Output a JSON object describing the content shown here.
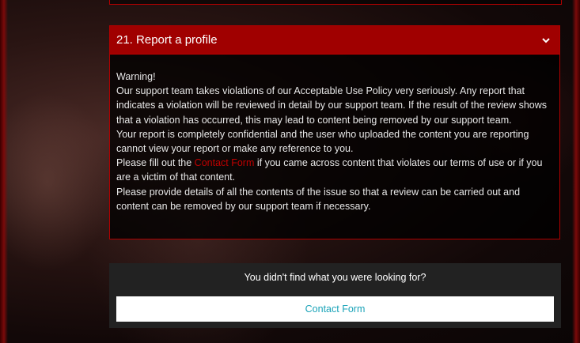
{
  "faq": {
    "title": "21. Report a profile",
    "paragraphs": {
      "warning": "Warning!",
      "p1": "Our support team takes violations of our Acceptable Use Policy very seriously. Any report that indicates a violation will be reviewed in detail by our support team. If the result of the review shows that a violation has occurred, this may lead to content being removed by our support team.",
      "p2": "Your report is completely confidential and the user who uploaded the content you are reporting cannot view your report or make any reference to you.",
      "p3_before": "Please fill out the ",
      "p3_link": "Contact Form",
      "p3_after": " if you came across content that violates our terms of use or if you are a victim of that content.",
      "p4": "Please provide details of all the contents of the issue so that a review can be carried out and content can be removed by our support team if necessary."
    },
    "icon": "chevron-down-icon"
  },
  "help": {
    "text": "You didn't find what you were looking for?",
    "button_label": "Contact Form"
  },
  "colors": {
    "accent": "#a00000",
    "border": "#b00000",
    "link": "#c00000",
    "button_text": "#1aa3b8"
  }
}
